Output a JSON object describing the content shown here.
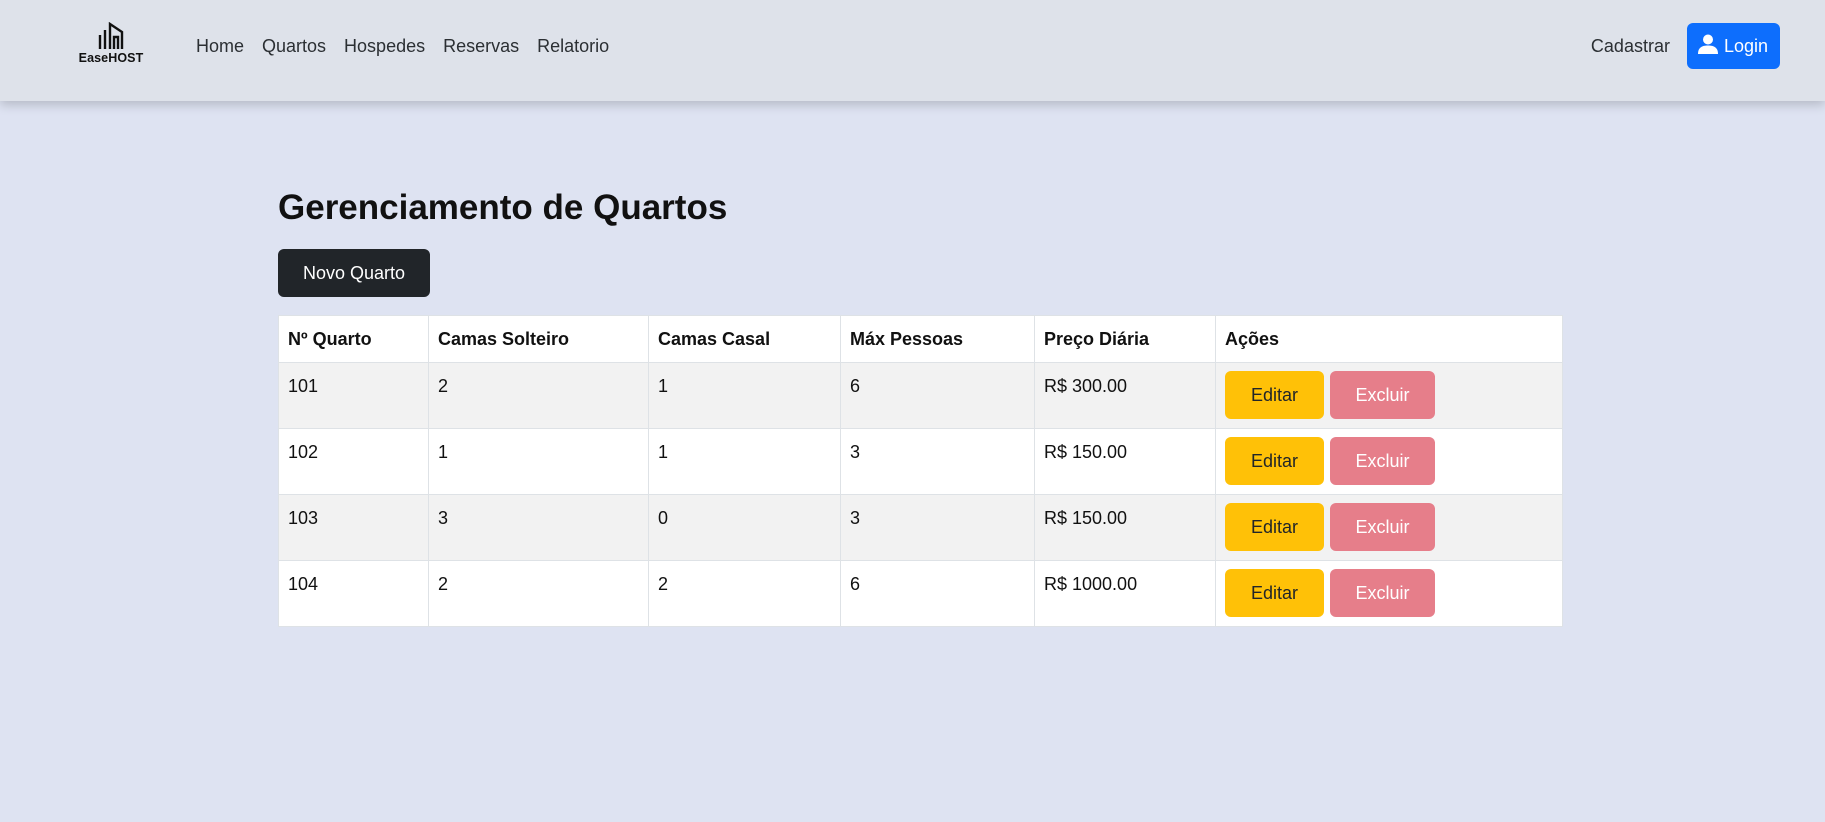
{
  "colors": {
    "page_bg": "#dee3f2",
    "navbar_bg": "#dee2ea",
    "primary": "#0d6efd",
    "dark": "#212529",
    "warning": "#ffc107",
    "danger_light": "#e67e8a"
  },
  "navbar": {
    "brand_text": "EaseHOST",
    "brand_icon": "buildings-logo-icon",
    "links": [
      "Home",
      "Quartos",
      "Hospedes",
      "Reservas",
      "Relatorio"
    ],
    "cadastrar_label": "Cadastrar",
    "login_label": "Login",
    "login_icon": "user-icon"
  },
  "main": {
    "title": "Gerenciamento de Quartos",
    "new_button_label": "Novo Quarto",
    "table": {
      "headers": [
        "Nº Quarto",
        "Camas Solteiro",
        "Camas Casal",
        "Máx Pessoas",
        "Preço Diária",
        "Ações"
      ],
      "rows": [
        {
          "numero": "101",
          "solteiro": "2",
          "casal": "1",
          "max": "6",
          "preco": "R$ 300.00"
        },
        {
          "numero": "102",
          "solteiro": "1",
          "casal": "1",
          "max": "3",
          "preco": "R$ 150.00"
        },
        {
          "numero": "103",
          "solteiro": "3",
          "casal": "0",
          "max": "3",
          "preco": "R$ 150.00"
        },
        {
          "numero": "104",
          "solteiro": "2",
          "casal": "2",
          "max": "6",
          "preco": "R$ 1000.00"
        }
      ],
      "edit_label": "Editar",
      "delete_label": "Excluir"
    }
  }
}
